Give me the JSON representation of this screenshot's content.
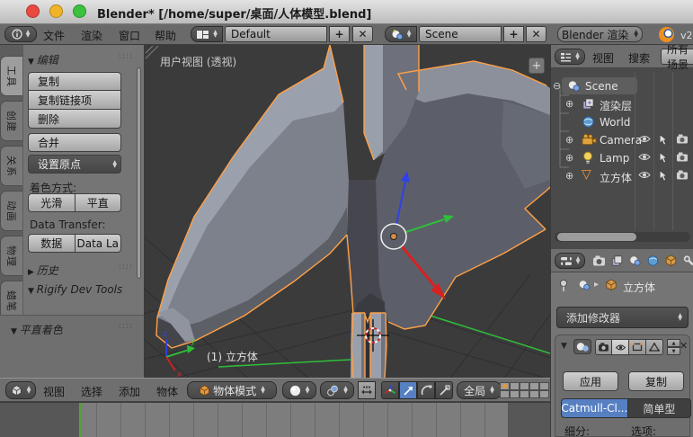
{
  "window": {
    "title": "Blender* [/home/super/桌面/人体模型.blend]"
  },
  "menubar": {
    "menus": [
      {
        "label": "文件"
      },
      {
        "label": "渲染"
      },
      {
        "label": "窗口"
      },
      {
        "label": "帮助"
      }
    ],
    "layout": {
      "value": "Default"
    },
    "scene": {
      "value": "Scene"
    },
    "engine": {
      "value": "Blender 渲染"
    },
    "version": "v2"
  },
  "toolshelf": {
    "tabs": [
      {
        "label": "工具"
      },
      {
        "label": "创建"
      },
      {
        "label": "关系"
      },
      {
        "label": "动画"
      },
      {
        "label": "物理"
      },
      {
        "label": "蜡笔"
      }
    ],
    "edit": {
      "title": "编辑",
      "duplicate": "复制",
      "duplicate_linked": "复制链接项",
      "delete": "删除",
      "join": "合并",
      "set_origin": "设置原点",
      "shading_label": "着色方式:",
      "smooth": "光滑",
      "flat": "平直",
      "data_transfer_label": "Data Transfer:",
      "data": "数据",
      "data_layout": "Data La",
      "history": "历史",
      "rigify": "Rigify Dev Tools"
    },
    "operator_panel": {
      "title": "平直着色"
    }
  },
  "viewport": {
    "view_label": "用户视图 (透视)",
    "object_label": "(1) 立方体",
    "gizmo": {
      "x": "x",
      "y": "y",
      "z": "z"
    }
  },
  "view_header": {
    "menus": [
      {
        "label": "视图"
      },
      {
        "label": "选择"
      },
      {
        "label": "添加"
      },
      {
        "label": "物体"
      }
    ],
    "mode": "物体模式",
    "orientation": "全局"
  },
  "outliner": {
    "view": "视图",
    "search": "搜索",
    "filter": "所有场景",
    "items": [
      {
        "label": "Scene"
      },
      {
        "label": "渲染层"
      },
      {
        "label": "World"
      },
      {
        "label": "Camera"
      },
      {
        "label": "Lamp"
      },
      {
        "label": "立方体"
      }
    ]
  },
  "properties": {
    "object": "立方体",
    "add_modifier": "添加修改器",
    "modifier": {
      "apply": "应用",
      "copy": "复制",
      "catmull": "Catmull-Cl...",
      "simple": "简单型",
      "subdivisions": "细分:",
      "options": "选项:"
    }
  },
  "colors": {
    "accent": "#ffa047",
    "active-blue": "#5680c2",
    "axis-red": "#d42322",
    "axis-green": "#2fbf3a",
    "axis-blue": "#3042e8",
    "timeline-green": "#53a339",
    "viewport-bg": "#3b3b3b"
  }
}
